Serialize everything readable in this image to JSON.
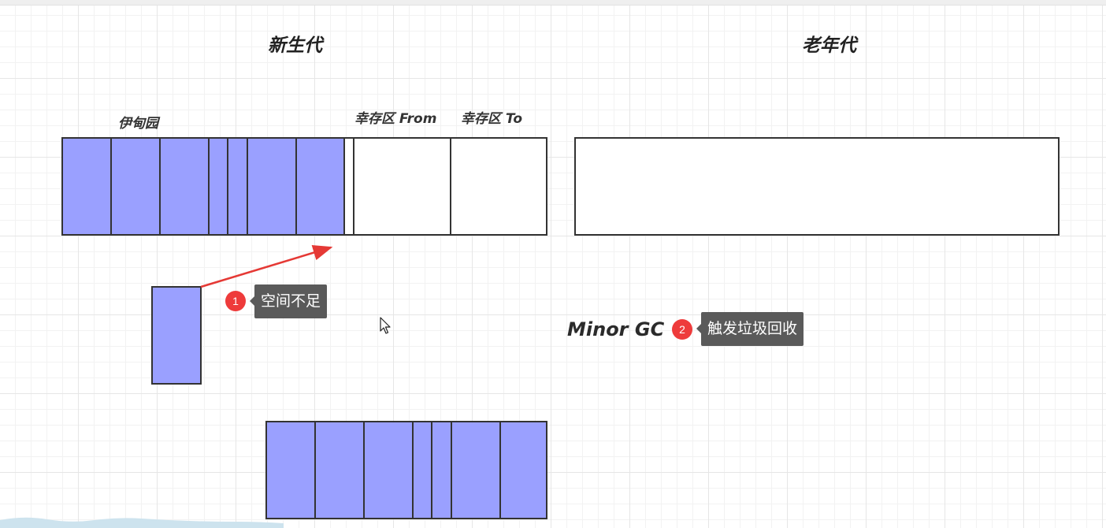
{
  "headings": {
    "young_gen": "新生代",
    "old_gen": "老年代"
  },
  "labels": {
    "eden": "伊甸园",
    "survivor_from": "幸存区 From",
    "survivor_to": "幸存区 To",
    "minor_gc": "Minor GC"
  },
  "annotations": [
    {
      "number": "1",
      "text": "空间不足"
    },
    {
      "number": "2",
      "text": "触发垃圾回收"
    }
  ],
  "colors": {
    "object_fill": "#9aa0ff",
    "outline": "#333333",
    "arrow": "#e53935",
    "badge": "#ee3b3b",
    "tooltip": "#5a5a5a"
  },
  "icons": {
    "cursor": "mouse-pointer-icon"
  }
}
